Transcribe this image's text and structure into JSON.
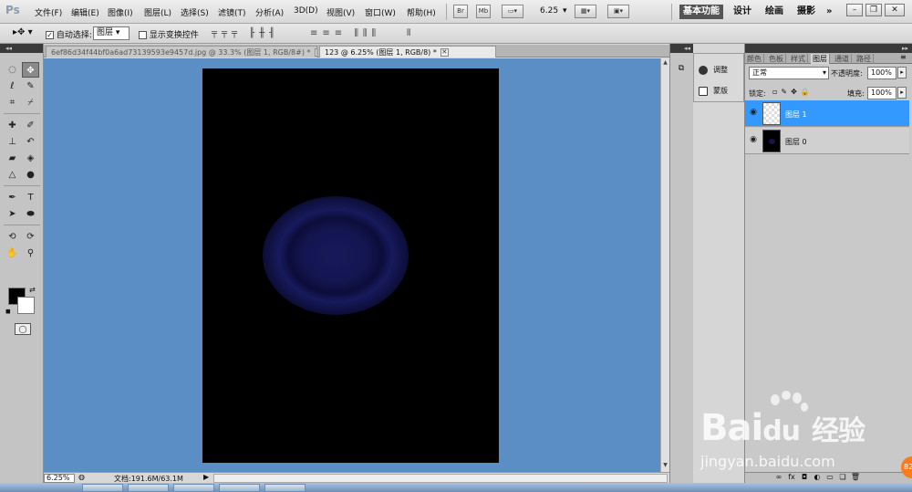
{
  "menubar": {
    "logo": "Ps",
    "items": [
      "文件(F)",
      "编辑(E)",
      "图像(I)",
      "图层(L)",
      "选择(S)",
      "滤镜(T)",
      "分析(A)",
      "3D(D)",
      "视图(V)",
      "窗口(W)",
      "帮助(H)"
    ],
    "icon_br": "Br",
    "icon_mb": "Mb",
    "zoom": "6.25",
    "workspaces": [
      "基本功能",
      "设计",
      "绘画",
      "摄影"
    ],
    "more": "»"
  },
  "options": {
    "auto_select_label": "自动选择:",
    "auto_select_value": "图层",
    "show_transform_label": "显示变换控件"
  },
  "tabs": [
    {
      "title": "6ef86d34f44bf0a6ad73139593e9457d.jpg @ 33.3% (图层 1, RGB/8#) *"
    },
    {
      "title": "123 @ 6.25% (图层 1, RGB/8) *"
    }
  ],
  "status": {
    "zoom": "6.25%",
    "doc_info": "文档:191.6M/63.1M"
  },
  "adjust_panel": {
    "items": [
      "调整",
      "蒙版"
    ]
  },
  "layers_panel": {
    "tabs": [
      "颜色",
      "色板",
      "样式",
      "图层",
      "通道",
      "路径"
    ],
    "active_tab": "图层",
    "blend_mode": "正常",
    "opacity_label": "不透明度:",
    "opacity_value": "100%",
    "lock_label": "锁定:",
    "fill_label": "填充:",
    "fill_value": "100%",
    "layers": [
      {
        "name": "图层 1",
        "selected": true
      },
      {
        "name": "图层 0",
        "selected": false
      }
    ]
  },
  "watermark": {
    "brand": "Bai",
    "brand_tail": "经验",
    "url": "jingyan.baidu.com",
    "badge": "82"
  },
  "colors": {
    "workspace_bg": "#5b8ec4",
    "selection": "#3399ff",
    "glow": "#17195a"
  }
}
